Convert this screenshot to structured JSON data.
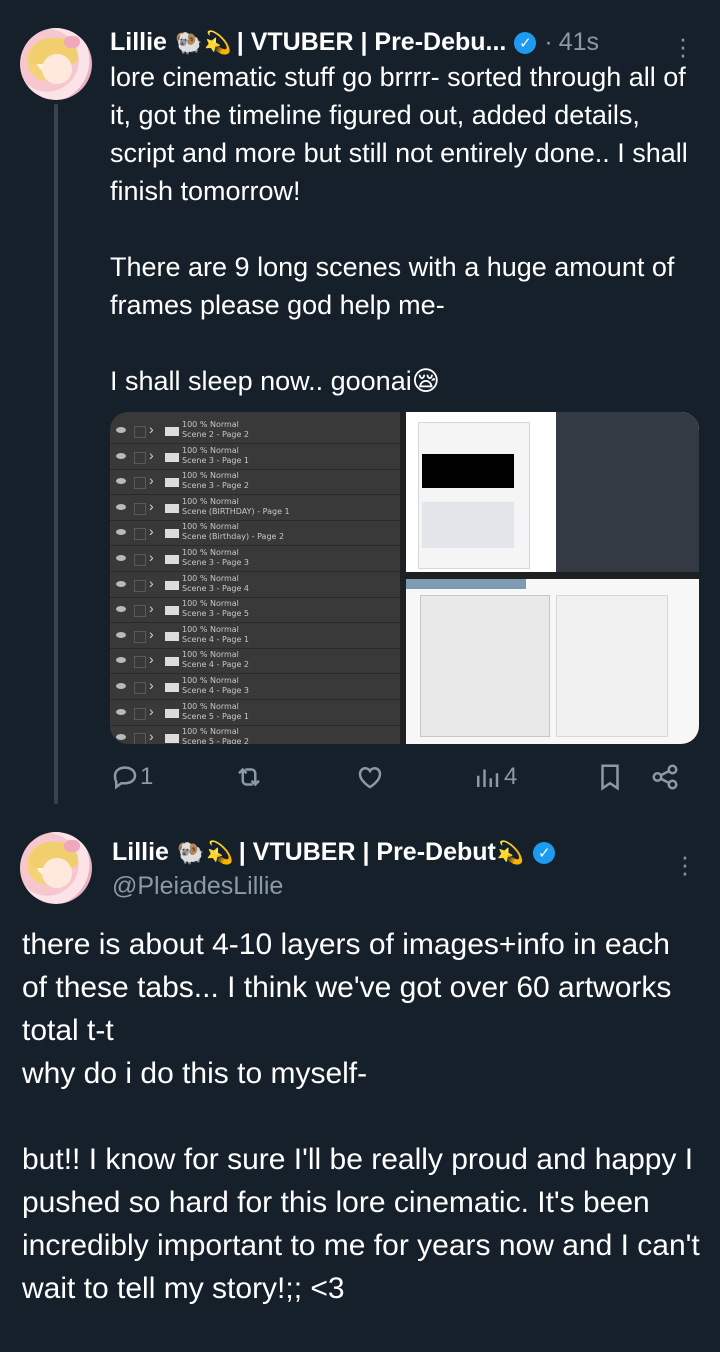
{
  "tweet1": {
    "display_name": "Lillie",
    "name_suffix": "| VTUBER | Pre-Debu...",
    "separator": "·",
    "time": "41s",
    "text": "lore cinematic stuff go brrrr- sorted through all of it, got the timeline figured out, added details, script and more but still not entirely done.. I shall finish tomorrow!\n\nThere are 9 long scenes with a huge amount of frames please god help me-\n\nI shall sleep now.. goonai😪",
    "media_layers": [
      {
        "line1": "100 % Normal",
        "line2": "Scene 2 - Page 2"
      },
      {
        "line1": "100 % Normal",
        "line2": "Scene 3 - Page 1"
      },
      {
        "line1": "100 % Normal",
        "line2": "Scene 3 - Page 2"
      },
      {
        "line1": "100 % Normal",
        "line2": "Scene (BIRTHDAY) - Page 1"
      },
      {
        "line1": "100 % Normal",
        "line2": "Scene (Birthday) - Page 2"
      },
      {
        "line1": "100 % Normal",
        "line2": "Scene 3 - Page 3"
      },
      {
        "line1": "100 % Normal",
        "line2": "Scene 3 - Page 4"
      },
      {
        "line1": "100 % Normal",
        "line2": "Scene 3 - Page 5"
      },
      {
        "line1": "100 % Normal",
        "line2": "Scene 4 - Page 1"
      },
      {
        "line1": "100 % Normal",
        "line2": "Scene 4 - Page 2"
      },
      {
        "line1": "100 % Normal",
        "line2": "Scene 4 - Page 3"
      },
      {
        "line1": "100 % Normal",
        "line2": "Scene 5 - Page 1"
      },
      {
        "line1": "100 % Normal",
        "line2": "Scene 5 - Page 2"
      }
    ],
    "actions": {
      "replies": "1",
      "reposts": "",
      "likes": "",
      "views": "4"
    }
  },
  "tweet2": {
    "display_name": "Lillie",
    "name_suffix": "| VTUBER | Pre-Debut",
    "handle": "@PleiadesLillie",
    "text": "there is about 4-10 layers of images+info in each of these tabs... I think we've got over 60 artworks total t-t\nwhy do i do this to myself-\n\nbut!! I know for sure I'll be really proud and happy I pushed so hard for this lore cinematic. It's been incredibly important to me for years now and I can't wait to tell my story!;; <3"
  },
  "icons": [
    "reply-icon",
    "repost-icon",
    "like-icon",
    "views-icon",
    "bookmark-icon",
    "share-icon",
    "more-icon",
    "verified-icon"
  ],
  "colors": {
    "background": "#15202b",
    "muted": "#8b98a5",
    "verified": "#1d9bf0",
    "thread_line": "#38444d"
  }
}
